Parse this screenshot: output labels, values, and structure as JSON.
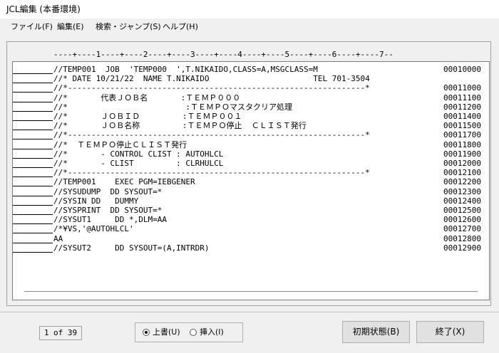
{
  "window": {
    "title": "JCL編集 (本番環境)"
  },
  "menu": [
    {
      "label": "ファイル(F)"
    },
    {
      "label": "編集(E)"
    },
    {
      "label": "検索・ジャンプ(S)"
    },
    {
      "label": "ヘルプ(H)"
    }
  ],
  "editor": {
    "ruler": "----+----1----+----2----+----3----+----4----+----5----+----6----+----7--",
    "lines": [
      {
        "code": "//TEMP001  JOB  'TEMP000  ',T.NIKAIDO,CLASS=A,MSGCLASS=M",
        "seq": "00010000"
      },
      {
        "code": "//* DATE 10/21/22  NAME T.NIKAIDO                      TEL 701-3504",
        "seq": ""
      },
      {
        "code": "//*---------------------------------------------------------------*",
        "seq": "00011000"
      },
      {
        "code": "//*       代表ＪＯＢ名       :ＴＥＭＰ０００",
        "seq": "00011100"
      },
      {
        "code": "//*                         :ＴＥＭＰＯマスタクリア処理",
        "seq": "00011200"
      },
      {
        "code": "//*       ＪＯＢＩＤ         :ＴＥＭＰ００１",
        "seq": "00011400"
      },
      {
        "code": "//*       ＪＯＢ名称         :ＴＥＭＰＯ停止  ＣＬＩＳＴ発行",
        "seq": "00011500"
      },
      {
        "code": "//*---------------------------------------------------------------*",
        "seq": "00011700"
      },
      {
        "code": "//*  ＴＥＭＰＯ停止ＣＬＩＳＴ発行",
        "seq": "00011800"
      },
      {
        "code": "//*       - CONTROL CLIST : AUTOHLCL",
        "seq": "00011900"
      },
      {
        "code": "//*       - CLIST         : CLRHULCL",
        "seq": "00012000"
      },
      {
        "code": "//*---------------------------------------------------------------*",
        "seq": "00012100"
      },
      {
        "code": "//TEMP001    EXEC PGM=IEBGENER",
        "seq": "00012200"
      },
      {
        "code": "//SYSUDUMP  DD SYSOUT=*",
        "seq": "00012300"
      },
      {
        "code": "//SYSIN DD   DUMMY",
        "seq": "00012400"
      },
      {
        "code": "//SYSPRINT  DD SYSOUT=*",
        "seq": "00012500"
      },
      {
        "code": "//SYSUT1     DD *,DLM=AA",
        "seq": "00012600"
      },
      {
        "code": "/*¥VS,'@AUTOHLCL'",
        "seq": "00012700"
      },
      {
        "code": "AA",
        "seq": "00012800"
      },
      {
        "code": "//SYSUT2     DD SYSOUT=(A,INTRDR)",
        "seq": "00012900"
      }
    ]
  },
  "footer": {
    "page_counter": "1 of 39",
    "mode_overwrite": "上書(U)",
    "mode_insert": "挿入(I)",
    "selected_mode": "overwrite",
    "reset_label": "初期状態(B)",
    "exit_label": "終了(X)"
  }
}
